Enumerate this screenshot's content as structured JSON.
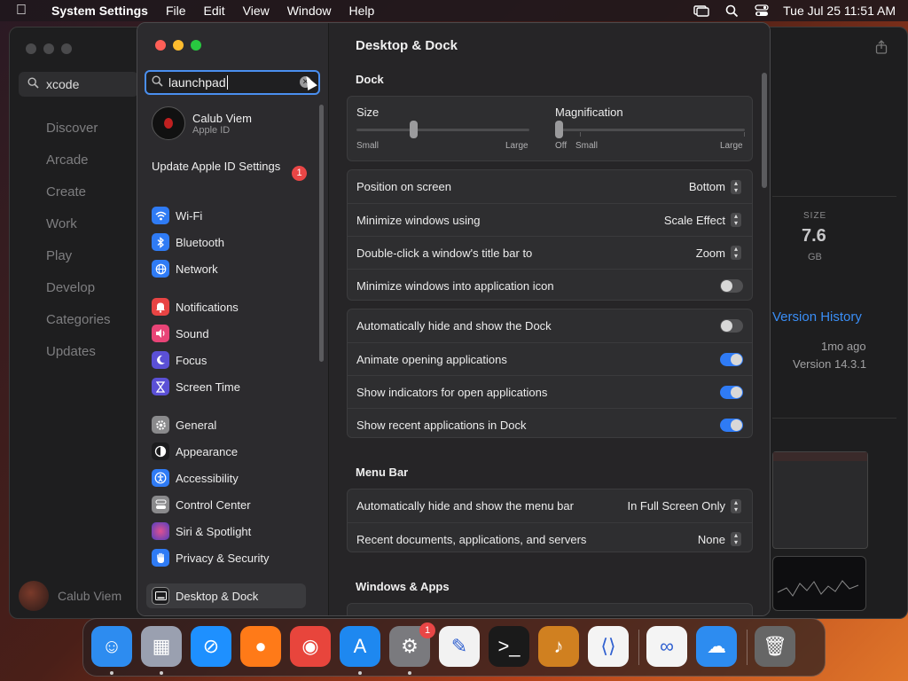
{
  "menubar": {
    "app_name": "System Settings",
    "menus": [
      "File",
      "Edit",
      "View",
      "Window",
      "Help"
    ],
    "clock": "Tue Jul 25  11:51 AM"
  },
  "appstore": {
    "search_value": "xcode",
    "nav": [
      "Discover",
      "Arcade",
      "Create",
      "Work",
      "Play",
      "Develop",
      "Categories",
      "Updates"
    ],
    "user_name": "Calub Viem",
    "size_label": "SIZE",
    "size_value": "7.6",
    "size_unit": "GB",
    "version_history": "Version History",
    "time_ago": "1mo ago",
    "version": "Version 14.3.1"
  },
  "sidebar": {
    "search_value": "launchpad",
    "account_name": "Calub Viem",
    "account_sub": "Apple ID",
    "update_label": "Update Apple ID Settings",
    "update_badge": "1",
    "items": [
      {
        "label": "Wi-Fi",
        "icon": "wifi-icon",
        "color": "#2f7bf5"
      },
      {
        "label": "Bluetooth",
        "icon": "bluetooth-icon",
        "color": "#2f7bf5"
      },
      {
        "label": "Network",
        "icon": "globe-icon",
        "color": "#2f7bf5"
      },
      {
        "label": "Notifications",
        "icon": "bell-icon",
        "color": "#e84444"
      },
      {
        "label": "Sound",
        "icon": "speaker-icon",
        "color": "#e84477"
      },
      {
        "label": "Focus",
        "icon": "moon-icon",
        "color": "#5b50d6"
      },
      {
        "label": "Screen Time",
        "icon": "hourglass-icon",
        "color": "#5b50d6"
      },
      {
        "label": "General",
        "icon": "gear-icon",
        "color": "#8a8a8c"
      },
      {
        "label": "Appearance",
        "icon": "appearance-icon",
        "color": "#1c1c1e"
      },
      {
        "label": "Accessibility",
        "icon": "accessibility-icon",
        "color": "#2f7bf5"
      },
      {
        "label": "Control Center",
        "icon": "control-center-icon",
        "color": "#8a8a8c"
      },
      {
        "label": "Siri & Spotlight",
        "icon": "siri-icon",
        "color": "#b040c0"
      },
      {
        "label": "Privacy & Security",
        "icon": "hand-icon",
        "color": "#2f7bf5"
      },
      {
        "label": "Desktop & Dock",
        "icon": "desktop-icon",
        "color": "#1c1c1e"
      }
    ]
  },
  "main": {
    "title": "Desktop & Dock",
    "dock_section": "Dock",
    "size_label": "Size",
    "size_small": "Small",
    "size_large": "Large",
    "size_fraction": 0.33,
    "mag_label": "Magnification",
    "mag_off": "Off",
    "mag_small": "Small",
    "mag_large": "Large",
    "mag_fraction": 0.0,
    "dock_rows": [
      {
        "label": "Position on screen",
        "value": "Bottom"
      },
      {
        "label": "Minimize windows using",
        "value": "Scale Effect"
      },
      {
        "label": "Double-click a window's title bar to",
        "value": "Zoom"
      }
    ],
    "minimize_icon_label": "Minimize windows into application icon",
    "minimize_icon_on": false,
    "toggles": [
      {
        "label": "Automatically hide and show the Dock",
        "on": false
      },
      {
        "label": "Animate opening applications",
        "on": true
      },
      {
        "label": "Show indicators for open applications",
        "on": true
      },
      {
        "label": "Show recent applications in Dock",
        "on": true
      }
    ],
    "menubar_section": "Menu Bar",
    "menubar_rows": [
      {
        "label": "Automatically hide and show the menu bar",
        "value": "In Full Screen Only"
      },
      {
        "label": "Recent documents, applications, and servers",
        "value": "None"
      }
    ],
    "windows_section": "Windows & Apps"
  },
  "dock": {
    "apps": [
      {
        "name": "finder",
        "color": "#2d8cf0",
        "glyph": "☺"
      },
      {
        "name": "launchpad",
        "color": "#9aa0b0",
        "glyph": "▦"
      },
      {
        "name": "safari",
        "color": "#1e90ff",
        "glyph": "⊘"
      },
      {
        "name": "firefox",
        "color": "#ff7a18",
        "glyph": "●"
      },
      {
        "name": "chrome",
        "color": "#e8453c",
        "glyph": "◉"
      },
      {
        "name": "app-store",
        "color": "#1e88f0",
        "glyph": "A"
      },
      {
        "name": "system-settings",
        "color": "#7a7a7e",
        "glyph": "⚙"
      },
      {
        "name": "textedit",
        "color": "#f2f2f2",
        "glyph": "✎"
      },
      {
        "name": "terminal",
        "color": "#1a1a1a",
        "glyph": ">_"
      },
      {
        "name": "garageband",
        "color": "#d08020",
        "glyph": "♪"
      },
      {
        "name": "vscode",
        "color": "#f4f4f4",
        "glyph": "⟨⟩"
      },
      {
        "name": "visual-studio",
        "color": "#f4f4f4",
        "glyph": "∞"
      },
      {
        "name": "weather",
        "color": "#2d8cf0",
        "glyph": "☁"
      },
      {
        "name": "trash",
        "color": "#666",
        "glyph": "🗑"
      }
    ],
    "settings_badge": "1"
  }
}
